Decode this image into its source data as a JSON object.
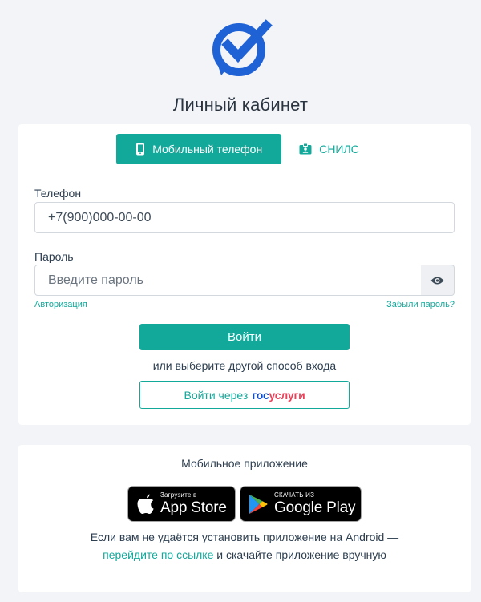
{
  "header": {
    "title": "Личный кабинет",
    "logo_icon": "checkmark-refresh-logo"
  },
  "login": {
    "tabs": [
      {
        "label": "Мобильный телефон",
        "icon": "mobile-phone-icon",
        "active": true
      },
      {
        "label": "СНИЛС",
        "icon": "id-card-icon",
        "active": false
      }
    ],
    "phone": {
      "label": "Телефон",
      "value": "+7(900)000-00-00"
    },
    "password": {
      "label": "Пароль",
      "placeholder": "Введите пароль"
    },
    "auth_link": "Авторизация",
    "forgot_link": "Забыли пароль?",
    "submit_label": "Войти",
    "alt_text": "или выберите другой способ входа",
    "gos_button": {
      "prefix": "Войти через",
      "brand_part1": "гос",
      "brand_part2": "услуги"
    }
  },
  "app": {
    "title": "Мобильное приложение",
    "appstore": {
      "small": "Загрузите в",
      "big": "App Store"
    },
    "googleplay": {
      "small": "СКАЧАТЬ ИЗ",
      "big": "Google Play"
    },
    "note_line1": "Если вам не удаётся установить приложение на Android —",
    "note_link": "перейдите по ссылке",
    "note_line2_rest": " и скачайте приложение вручную"
  },
  "colors": {
    "accent": "#12a99b",
    "background": "#f2f4f8",
    "logo_blue": "#1f62d6",
    "gos_blue": "#0d4cd3",
    "gos_red": "#ee3f58"
  }
}
